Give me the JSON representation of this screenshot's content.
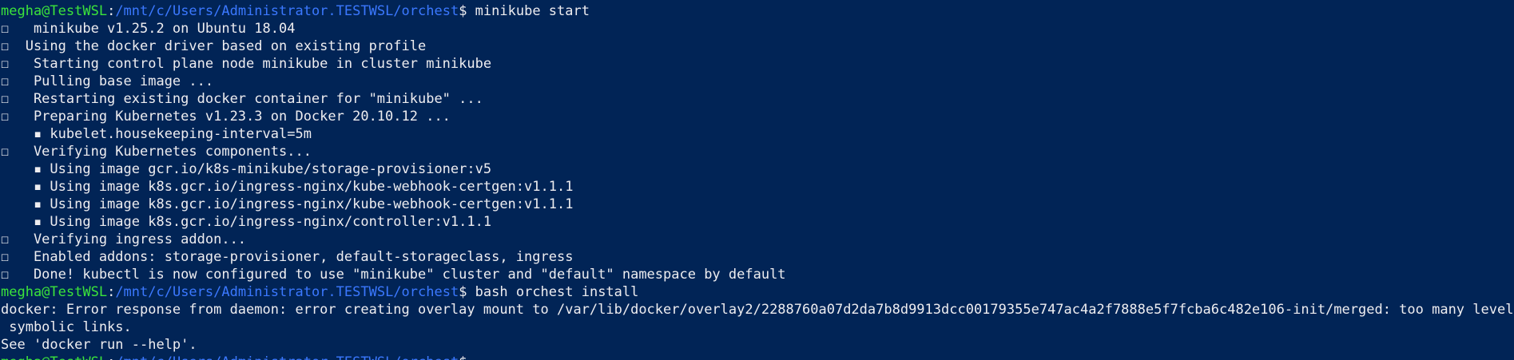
{
  "colors": {
    "background": "#012456",
    "foreground": "#eeedf0",
    "prompt_user": "#3be33b",
    "prompt_path": "#3b78ff"
  },
  "prompt": {
    "user_host": "megha@TestWSL",
    "path": "/mnt/c/Users/Administrator.TESTWSL/orchest",
    "symbol": "$ "
  },
  "commands": {
    "first": "minikube start",
    "second": "bash orchest install"
  },
  "output_lines": [
    "☐   minikube v1.25.2 on Ubuntu 18.04",
    "☐  Using the docker driver based on existing profile",
    "☐   Starting control plane node minikube in cluster minikube",
    "☐   Pulling base image ...",
    "☐   Restarting existing docker container for \"minikube\" ...",
    "☐   Preparing Kubernetes v1.23.3 on Docker 20.10.12 ...",
    "    ▪ kubelet.housekeeping-interval=5m",
    "☐   Verifying Kubernetes components...",
    "    ▪ Using image gcr.io/k8s-minikube/storage-provisioner:v5",
    "    ▪ Using image k8s.gcr.io/ingress-nginx/kube-webhook-certgen:v1.1.1",
    "    ▪ Using image k8s.gcr.io/ingress-nginx/kube-webhook-certgen:v1.1.1",
    "    ▪ Using image k8s.gcr.io/ingress-nginx/controller:v1.1.1",
    "☐   Verifying ingress addon...",
    "☐   Enabled addons: storage-provisioner, default-storageclass, ingress",
    "☐   Done! kubectl is now configured to use \"minikube\" cluster and \"default\" namespace by default"
  ],
  "error_lines": [
    "docker: Error response from daemon: error creating overlay mount to /var/lib/docker/overlay2/2288760a07d2da7b8d9913dcc00179355e747ac4a2f7888e5f7fcba6c482e106-init/merged: too many levels of",
    " symbolic links.",
    "See 'docker run --help'."
  ]
}
